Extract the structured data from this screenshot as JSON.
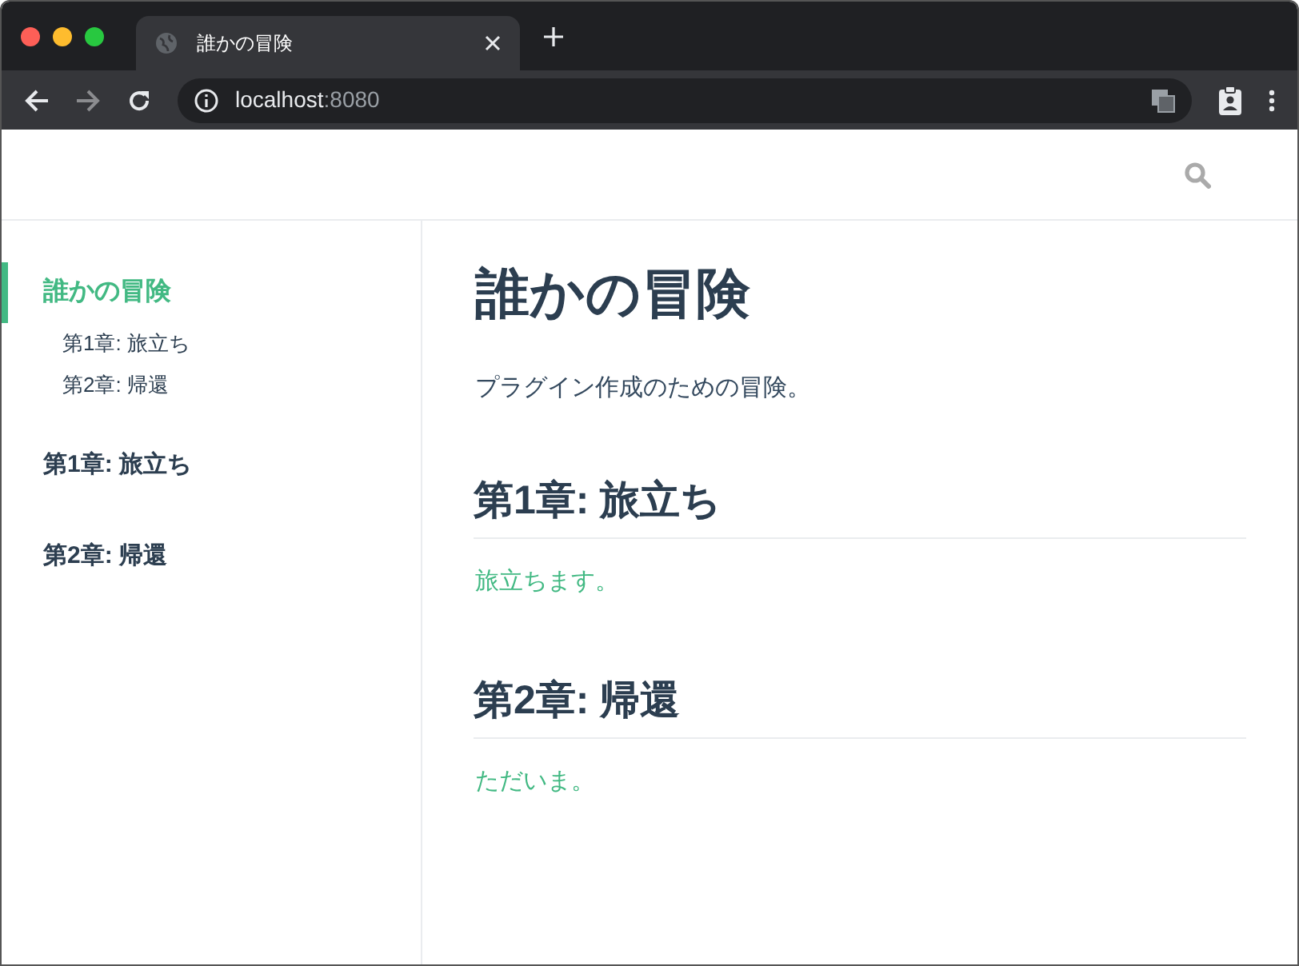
{
  "browser": {
    "tab": {
      "title": "誰かの冒険"
    },
    "address": {
      "host": "localhost",
      "port": ":8080"
    }
  },
  "sidebar": {
    "items": [
      {
        "label": "誰かの冒険",
        "selected": true,
        "children": [
          {
            "label": "第1章: 旅立ち",
            "selected": false
          },
          {
            "label": "第2章: 帰還",
            "selected": false
          }
        ]
      },
      {
        "label": "第1章: 旅立ち",
        "selected": false
      },
      {
        "label": "第2章: 帰還",
        "selected": false
      }
    ]
  },
  "content": {
    "title": "誰かの冒険",
    "intro": "プラグイン作成のための冒険。",
    "sections": [
      {
        "heading": "第1章: 旅立ち",
        "body": "旅立ちます。"
      },
      {
        "heading": "第2章: 帰還",
        "body": "ただいま。"
      }
    ]
  }
}
